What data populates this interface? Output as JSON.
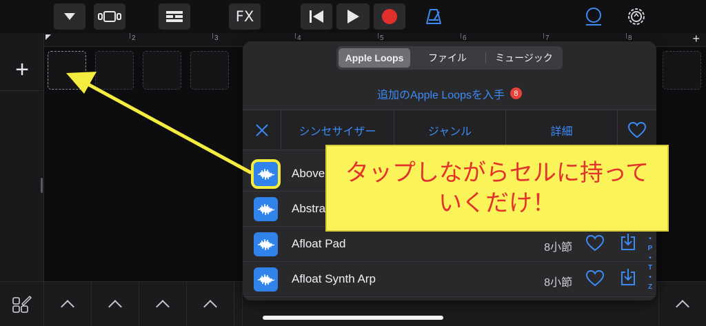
{
  "toolbar": {
    "fx_label": "FX"
  },
  "ruler": {
    "marks": [
      "2",
      "3",
      "4",
      "5",
      "6",
      "7",
      "8"
    ],
    "add_label": "+"
  },
  "tracks": {
    "add_label": "+"
  },
  "browser": {
    "tabs": [
      {
        "label": "Apple Loops",
        "selected": true
      },
      {
        "label": "ファイル",
        "selected": false
      },
      {
        "label": "ミュージック",
        "selected": false
      }
    ],
    "more_loops_label": "追加のApple Loopsを入手",
    "more_loops_badge": "8",
    "filters": [
      "シンセサイザー",
      "ジャンル",
      "詳細"
    ],
    "loops": [
      {
        "name": "Above",
        "bars": ""
      },
      {
        "name": "Abstra",
        "bars": ""
      },
      {
        "name": "Afloat Pad",
        "bars": "8小節"
      },
      {
        "name": "Afloat Synth Arp",
        "bars": "8小節"
      }
    ],
    "index_letters": [
      "P",
      "T",
      "Z"
    ]
  },
  "annotation": {
    "line1": "タップしながらセルに持って",
    "line2": "いくだけ！"
  },
  "colors": {
    "accent_blue": "#3c8bf5",
    "record_red": "#e0302a",
    "metronome_blue": "#3c8bf5",
    "callout_yellow": "#fbf35a",
    "callout_text_red": "#e2332c",
    "badge_red": "#e8413a"
  }
}
